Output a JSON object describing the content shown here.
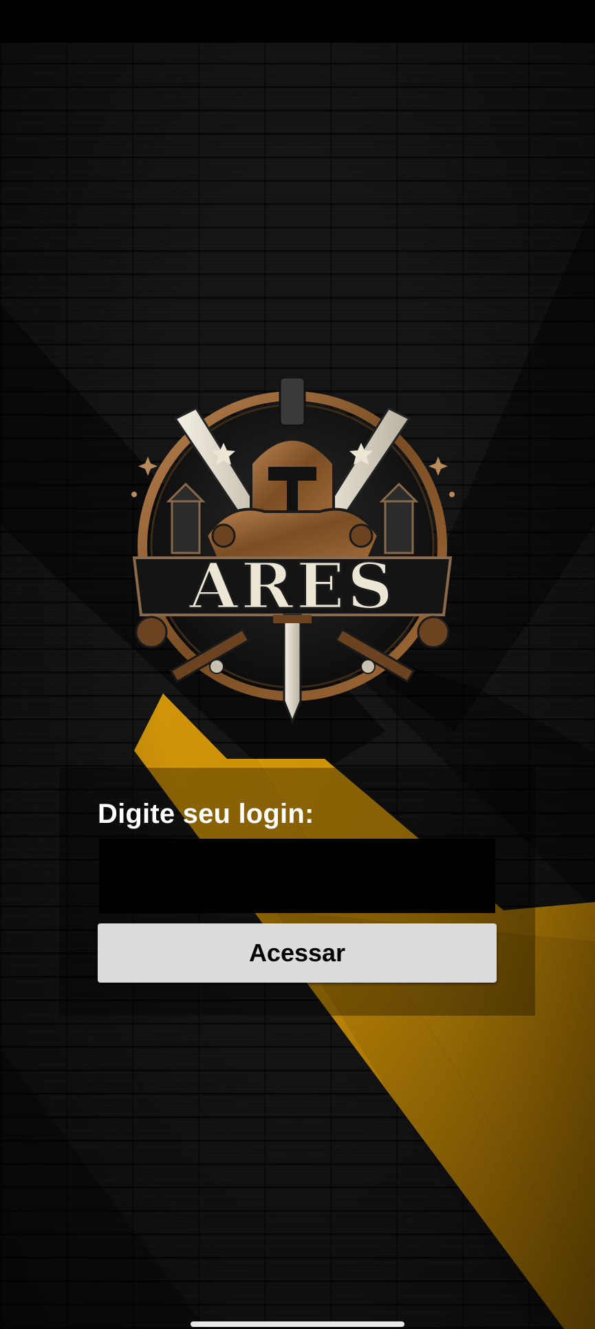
{
  "logo": {
    "text": "ARES",
    "icon": "spartan-warrior-emblem"
  },
  "login": {
    "label": "Digite seu login:",
    "input_value": "",
    "input_placeholder": "",
    "button_label": "Acessar"
  },
  "colors": {
    "background": "#151515",
    "accent": "#C48A05",
    "panel_overlay": "rgba(0,0,0,0.33)",
    "input_bg": "#000000",
    "button_bg": "#DCDCDC",
    "logo_bronze": "#8A5A2B",
    "logo_cream": "#ECE6D4"
  }
}
